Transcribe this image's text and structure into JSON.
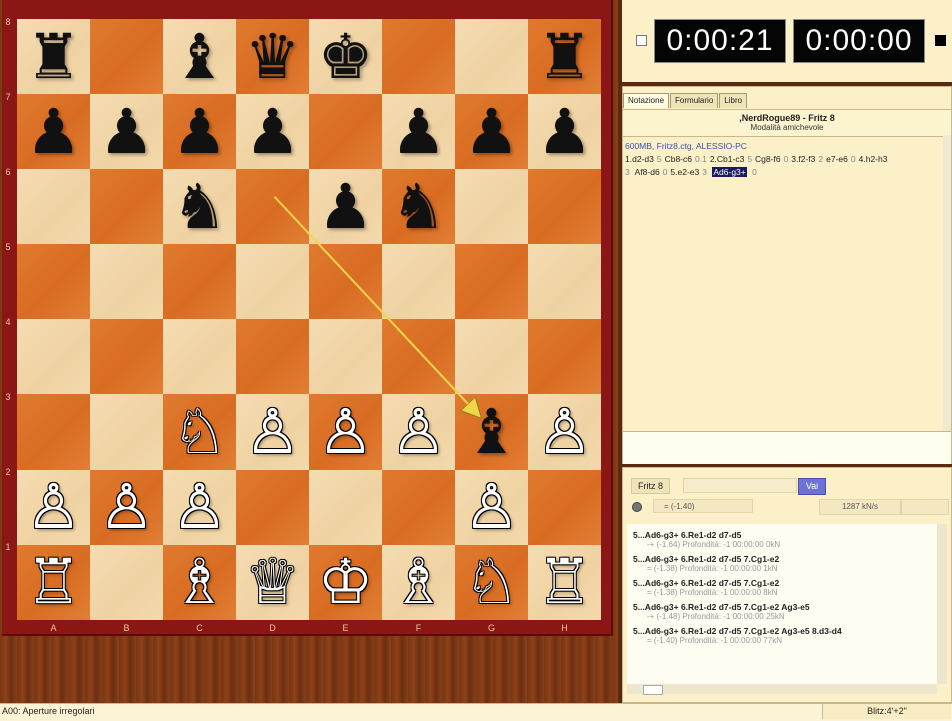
{
  "board": {
    "files": [
      "A",
      "B",
      "C",
      "D",
      "E",
      "F",
      "G",
      "H"
    ],
    "ranks": [
      "8",
      "7",
      "6",
      "5",
      "4",
      "3",
      "2",
      "1"
    ],
    "squares": [
      [
        "♜",
        "",
        "♝",
        "♛",
        "♚",
        "",
        "",
        "♜"
      ],
      [
        "♟",
        "♟",
        "♟",
        "♟",
        "",
        "♟",
        "♟",
        "♟"
      ],
      [
        "",
        "",
        "♞",
        "",
        "♟",
        "♞",
        "",
        ""
      ],
      [
        "",
        "",
        "",
        "",
        "",
        "",
        "",
        ""
      ],
      [
        "",
        "",
        "",
        "",
        "",
        "",
        "",
        ""
      ],
      [
        "",
        "",
        "♘",
        "♙",
        "♙",
        "♙",
        "♝",
        "♙"
      ],
      [
        "♙",
        "♙",
        "♙",
        "",
        "",
        "",
        "♙",
        ""
      ],
      [
        "♖",
        "",
        "♗",
        "♕",
        "♔",
        "♗",
        "♘",
        "♖"
      ]
    ],
    "arrow": {
      "from": "d6",
      "to": "g3",
      "color": "#f0d64a"
    }
  },
  "clock": {
    "left": "0:00:21",
    "right": "0:00:00"
  },
  "notation": {
    "tabs": [
      "Notazione",
      "Formulario",
      "Libro"
    ],
    "title": ",NerdRogue89 - Fritz 8",
    "mode": "Modalità amichevole",
    "info": "600MB, Fritz8.ctg, ALESSIO-PC",
    "line1": [
      {
        "m": "1.d2-d3",
        "e": "5"
      },
      {
        "m": "Cb8-c6",
        "e": "0.1"
      },
      {
        "m": "2.Cb1-c3",
        "e": "5"
      },
      {
        "m": "Cg8-f6",
        "e": "0"
      },
      {
        "m": "3.f2-f3",
        "e": "2"
      },
      {
        "m": "e7-e6",
        "e": "0"
      },
      {
        "m": "4.h2-h3",
        "e": ""
      }
    ],
    "line2_lead": "3",
    "line2": [
      {
        "m": "Af8-d6",
        "e": "0"
      },
      {
        "m": "5.e2-e3",
        "e": "3"
      }
    ],
    "selected_move": "Ad6-g3+",
    "selected_eval": "0"
  },
  "engine": {
    "name": "Fritz 8",
    "go_label": "Vai",
    "eval": "=  (-1.40)",
    "speed": "1287 kN/s",
    "lines": [
      {
        "moves": "5...Ad6-g3+ 6.Re1-d2 d7-d5",
        "info": "-+  (-1.64)   Profondità: -1   00:00:00  0kN"
      },
      {
        "moves": "5...Ad6-g3+ 6.Re1-d2 d7-d5 7.Cg1-e2",
        "info": "=  (-1.38)   Profondità: -1   00:00:00  1kN"
      },
      {
        "moves": "5...Ad6-g3+ 6.Re1-d2 d7-d5 7.Cg1-e2",
        "info": "=  (-1.38)   Profondità: -1   00:00:00  8kN"
      },
      {
        "moves": "5...Ad6-g3+ 6.Re1-d2 d7-d5 7.Cg1-e2 Ag3-e5",
        "info": "-+  (-1.48)   Profondità: -1   00:00:00  25kN"
      },
      {
        "moves": "5...Ad6-g3+ 6.Re1-d2 d7-d5 7.Cg1-e2 Ag3-e5 8.d3-d4",
        "info": "=  (-1.40)   Profondità: -1   00:00:00  77kN"
      }
    ]
  },
  "status": {
    "left": "A00: Aperture irregolari",
    "right": "Blitz:4'+2\""
  },
  "colors": {
    "light_square": "#f4dcb2",
    "dark_square": "#e07a2e",
    "frame": "#8a1616"
  }
}
